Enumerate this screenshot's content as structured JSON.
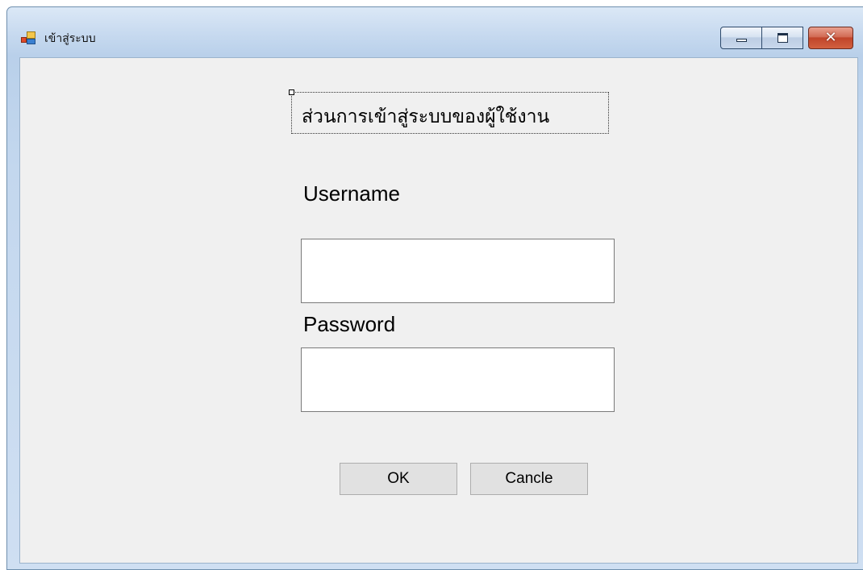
{
  "window": {
    "title": "เข้าสู่ระบบ",
    "close_glyph": "✕"
  },
  "form": {
    "heading": "ส่วนการเข้าสู่ระบบของผู้ใช้งาน",
    "username_label": "Username",
    "username_value": "",
    "password_label": "Password",
    "password_value": "",
    "ok_label": "OK",
    "cancel_label": "Cancle"
  },
  "icons": {
    "app": "form-app-icon",
    "minimize": "minimize-icon",
    "maximize": "maximize-icon",
    "close": "close-icon"
  },
  "colors": {
    "client_background": "#f0f0f0",
    "close_button": "#c0442a",
    "input_background": "#ffffff"
  }
}
